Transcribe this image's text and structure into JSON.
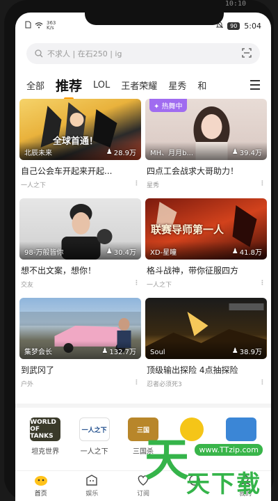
{
  "status_bar": {
    "network_speed_value": "363",
    "network_speed_unit": "K/s",
    "battery": "90",
    "time": "5:04",
    "top_clock": "10:10"
  },
  "search": {
    "placeholder": "不求人 | 在石250 | ig"
  },
  "tabs": [
    "全部",
    "推荐",
    "LOL",
    "王者荣耀",
    "星秀",
    "和"
  ],
  "cards": [
    {
      "anchor": "北辰未来",
      "views": "28.9万",
      "title": "自己公会车开起来开起...",
      "category": "一人之下",
      "badge": ""
    },
    {
      "anchor": "MH、月月b...",
      "views": "39.4万",
      "title": "四点工会战求大哥助力！",
      "category": "星秀",
      "badge": "热舞中"
    },
    {
      "anchor": "98-万般皆你",
      "views": "30.4万",
      "title": "想不出文案，想你！",
      "category": "交友",
      "badge": ""
    },
    {
      "anchor": "XD-星瞳",
      "views": "41.8万",
      "title": "格斗战神，带你征服四方",
      "category": "一人之下",
      "badge": ""
    },
    {
      "anchor": "集梦会长",
      "views": "132.7万",
      "title": "到武冈了",
      "category": "户外",
      "badge": ""
    },
    {
      "anchor": "Soul",
      "views": "38.9万",
      "title": "顶级输出探险 4点抽探险",
      "category": "忍者必须死3",
      "badge": ""
    }
  ],
  "thumb_overlays": {
    "card1_banner": "全球首通！",
    "card4_banner": "联赛导师第一人"
  },
  "games": [
    {
      "name": "坦克世界",
      "logo": "WORLD OF TANKS"
    },
    {
      "name": "一人之下",
      "logo": "一人之下"
    },
    {
      "name": "三国杀",
      "logo": "三国"
    },
    {
      "name": "",
      "logo": ""
    },
    {
      "name": "",
      "logo": ""
    }
  ],
  "nav": {
    "items": [
      "首页",
      "娱乐",
      "订阅",
      "",
      "我的"
    ]
  },
  "watermark": {
    "url": "www.TTzip.com",
    "big": "天",
    "sub": "天下载"
  },
  "colors": {
    "accent": "#ff9a00",
    "badge": "#a06cf0",
    "watermark": "#35b44a"
  }
}
